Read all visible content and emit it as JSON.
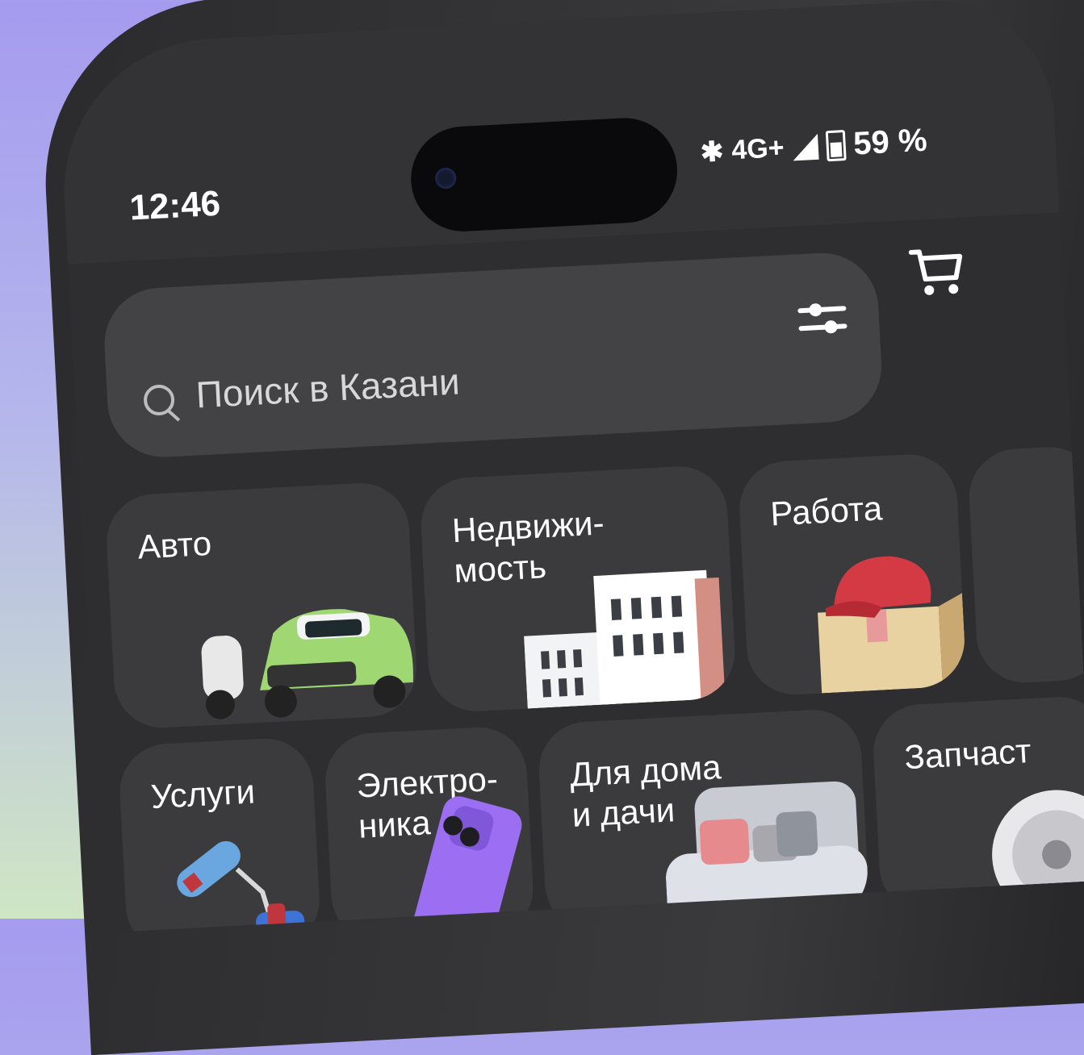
{
  "status_bar": {
    "time": "12:46",
    "network": "4G+",
    "battery": "59 %",
    "icons": [
      "bluetooth-icon",
      "signal-icon",
      "battery-icon"
    ]
  },
  "search": {
    "placeholder": "Поиск в Казани"
  },
  "header_icons": [
    "search-icon",
    "filter-icon",
    "cart-icon"
  ],
  "categories": [
    {
      "label_lines": [
        "Авто"
      ],
      "icon": "car-scooter-image"
    },
    {
      "label_lines": [
        "Недвижи-",
        "мость"
      ],
      "icon": "buildings-image"
    },
    {
      "label_lines": [
        "Работа"
      ],
      "icon": "cap-box-image"
    },
    {
      "label_lines": [
        "Услуги"
      ],
      "icon": "paint-roller-image"
    },
    {
      "label_lines": [
        "Электро-",
        "ника"
      ],
      "icon": "phone-image"
    },
    {
      "label_lines": [
        "Для дома",
        "и дачи"
      ],
      "icon": "sofa-image"
    },
    {
      "label_lines": [
        "Запчаст"
      ],
      "icon": "wheel-image"
    }
  ],
  "colors": {
    "background_top": "#a59bef",
    "background_bottom": "#cfe6c4",
    "screen": "#2e2e30",
    "tile": "#3b3b3d",
    "search_field": "#434345",
    "text": "#ffffff"
  }
}
